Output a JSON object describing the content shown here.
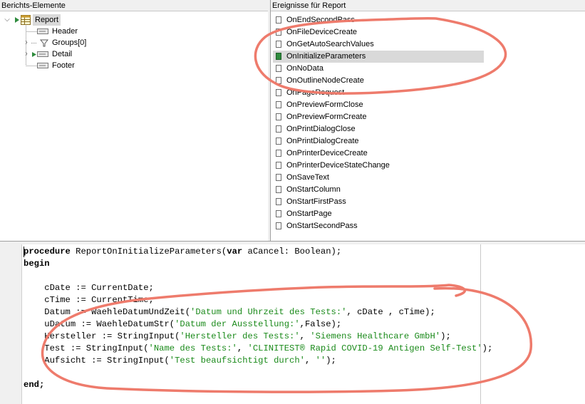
{
  "left_panel": {
    "title": "Berichts-Elemente",
    "tree": [
      {
        "label": "Report",
        "level": 0,
        "toggle": "⌵",
        "selected": true
      },
      {
        "label": "Header",
        "level": 1,
        "toggle": ""
      },
      {
        "label": "Groups[0]",
        "level": 1,
        "toggle": "›"
      },
      {
        "label": "Detail",
        "level": 1,
        "toggle": "›"
      },
      {
        "label": "Footer",
        "level": 1,
        "toggle": ""
      }
    ]
  },
  "right_panel": {
    "title": "Ereignisse für Report",
    "events": [
      "OnEndSecondPass",
      "OnFileDeviceCreate",
      "OnGetAutoSearchValues",
      "OnInitializeParameters",
      "OnNoData",
      "OnOutlineNodeCreate",
      "OnPageRequest",
      "OnPreviewFormClose",
      "OnPreviewFormCreate",
      "OnPrintDialogClose",
      "OnPrintDialogCreate",
      "OnPrinterDeviceCreate",
      "OnPrinterDeviceStateChange",
      "OnSaveText",
      "OnStartColumn",
      "OnStartFirstPass",
      "OnStartPage",
      "OnStartSecondPass"
    ],
    "selected_event": "OnInitializeParameters"
  },
  "editor": {
    "lines": [
      [
        [
          "kw",
          "procedure"
        ],
        [
          "p",
          " ReportOnInitializeParameters("
        ],
        [
          "kw",
          "var"
        ],
        [
          "p",
          " aCancel: Boolean);"
        ]
      ],
      [
        [
          "kw",
          "begin"
        ]
      ],
      [],
      [
        [
          "p",
          "    cDate := CurrentDate;"
        ]
      ],
      [
        [
          "p",
          "    cTime := CurrentTime;"
        ]
      ],
      [
        [
          "p",
          "    Datum := WaehleDatumUndZeit("
        ],
        [
          "s",
          "'Datum und Uhrzeit des Tests:'"
        ],
        [
          "p",
          ", cDate , cTime);"
        ]
      ],
      [
        [
          "p",
          "    uDatum := WaehleDatumStr("
        ],
        [
          "s",
          "'Datum der Ausstellung:'"
        ],
        [
          "p",
          ",False);"
        ]
      ],
      [
        [
          "p",
          "    Hersteller := StringInput("
        ],
        [
          "s",
          "'Hersteller des Tests:'"
        ],
        [
          "p",
          ", "
        ],
        [
          "s",
          "'Siemens Healthcare GmbH'"
        ],
        [
          "p",
          ");"
        ]
      ],
      [
        [
          "p",
          "    Test := StringInput("
        ],
        [
          "s",
          "'Name des Tests:'"
        ],
        [
          "p",
          ", "
        ],
        [
          "s",
          "'CLINITEST® Rapid COVID-19 Antigen Self-Test'"
        ],
        [
          "p",
          ");"
        ]
      ],
      [
        [
          "p",
          "    Aufsicht := StringInput("
        ],
        [
          "s",
          "'Test beaufsichtigt durch'"
        ],
        [
          "p",
          ", "
        ],
        [
          "s",
          "''"
        ],
        [
          "p",
          ");"
        ]
      ],
      [],
      [
        [
          "kw",
          "end;"
        ]
      ]
    ]
  },
  "colors": {
    "annotation": "#ee7b6c",
    "string": "#1a8a1a",
    "selected_row": "#d9d9d9"
  }
}
